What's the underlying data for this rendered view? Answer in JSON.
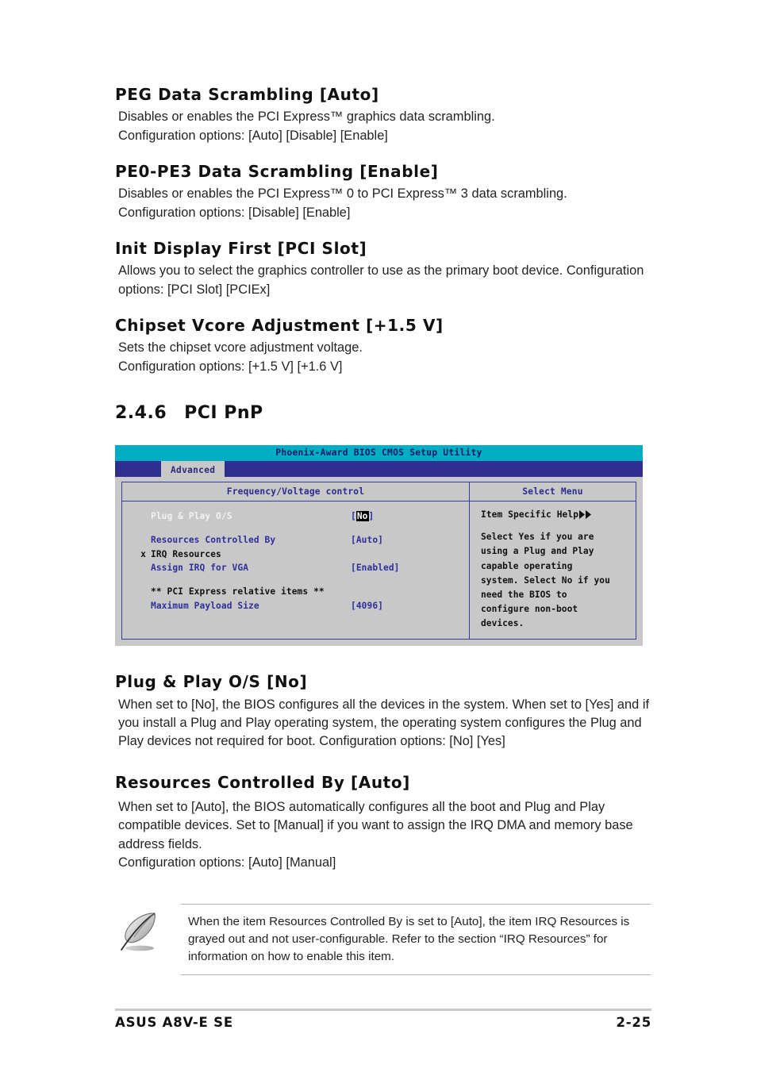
{
  "document": {
    "footer_left": "ASUS A8V-E SE",
    "footer_page": "2-25"
  },
  "items": [
    {
      "title": "PEG Data Scrambling [Auto]",
      "body": "Disables or enables the PCI Express™ graphics data scrambling.\nConfiguration options: [Auto] [Disable] [Enable]"
    },
    {
      "title": "PE0-PE3 Data Scrambling [Enable]",
      "body": "Disables or enables the PCI Express™ 0 to PCI Express™ 3 data scrambling.\nConfiguration options: [Disable] [Enable]"
    },
    {
      "title": "Init Display First [PCI Slot]",
      "body": "Allows you to select the graphics controller to use as the primary boot device. Configuration options: [PCI Slot] [PCIEx]"
    },
    {
      "title": "Chipset Vcore Adjustment [+1.5 V]",
      "body": "Sets the chipset vcore adjustment voltage.\nConfiguration options: [+1.5 V] [+1.6 V]"
    }
  ],
  "section": {
    "number": "2.4.6",
    "name": "PCI PnP"
  },
  "bios": {
    "title": "Phoenix-Award BIOS CMOS Setup Utility",
    "tab": "Advanced",
    "column_headers": {
      "left": "Frequency/Voltage control",
      "right": "Select Menu"
    },
    "rows": [
      {
        "marker": "",
        "label": "Plug & Play O/S",
        "value_prefix": "[",
        "value_highlight": "No",
        "value_suffix": "]",
        "style": "white"
      },
      {
        "marker": "",
        "label": "",
        "value": "",
        "style": "gap"
      },
      {
        "marker": "",
        "label": "Resources Controlled By",
        "value": "[Auto]",
        "style": "blue"
      },
      {
        "marker": "x",
        "label": "IRQ Resources",
        "value": "",
        "style": "dark"
      },
      {
        "marker": "",
        "label": "Assign IRQ for VGA",
        "value": "[Enabled]",
        "style": "blue"
      },
      {
        "marker": "",
        "label": "",
        "value": "",
        "style": "gap"
      },
      {
        "marker": "",
        "label": "** PCI Express relative items **",
        "value": "",
        "style": "dark"
      },
      {
        "marker": "",
        "label": "Maximum Payload Size",
        "value": "[4096]",
        "style": "blue"
      }
    ],
    "help": {
      "title": "Item Specific Help",
      "text": "Select Yes if you are\nusing a Plug and Play\ncapable operating\nsystem. Select No if you\nneed the BIOS to\nconfigure non-boot\ndevices."
    },
    "colors": {
      "titlebar": "#00aec4",
      "menubar": "#2e2f91",
      "panel": "#c8c8c8",
      "border": "#3b3b9e",
      "label_blue": "#2f2f9c"
    }
  },
  "lower_items": [
    {
      "title": "Plug & Play O/S [No]",
      "body": "When set to [No], the BIOS configures all the devices in the system. When set to [Yes] and if you install a Plug and Play operating system, the operating system configures the Plug and Play devices not required for boot. Configuration options: [No] [Yes]"
    },
    {
      "title": "Resources Controlled By [Auto]",
      "body": "When set to [Auto], the BIOS automatically configures all the boot and Plug and Play compatible devices. Set to [Manual] if you want to assign the IRQ DMA and memory base address fields.\nConfiguration options: [Auto] [Manual]"
    }
  ],
  "note": {
    "text": "When the item Resources Controlled By is set to [Auto], the item IRQ Resources is grayed out and not user-configurable. Refer to the section “IRQ Resources” for information on how to enable this item."
  }
}
